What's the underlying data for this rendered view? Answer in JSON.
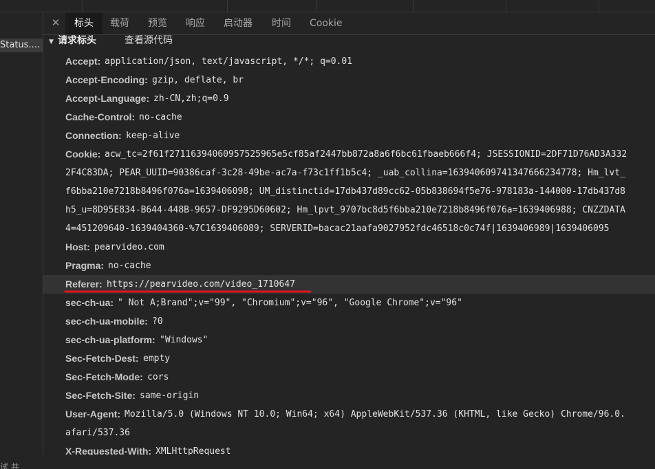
{
  "left_column": {
    "status_label": "Status....",
    "bottom_text": "试 共"
  },
  "tabs": {
    "close_icon": "close-icon",
    "items": [
      {
        "label": "标头",
        "active": true
      },
      {
        "label": "载荷",
        "active": false
      },
      {
        "label": "预览",
        "active": false
      },
      {
        "label": "响应",
        "active": false
      },
      {
        "label": "启动器",
        "active": false
      },
      {
        "label": "时间",
        "active": false
      },
      {
        "label": "Cookie",
        "active": false
      }
    ]
  },
  "section": {
    "title": "请求标头",
    "view_source": "查看源代码"
  },
  "headers": [
    {
      "key": "Accept:",
      "value": "application/json, text/javascript, */*; q=0.01"
    },
    {
      "key": "Accept-Encoding:",
      "value": "gzip, deflate, br"
    },
    {
      "key": "Accept-Language:",
      "value": "zh-CN,zh;q=0.9"
    },
    {
      "key": "Cache-Control:",
      "value": "no-cache"
    },
    {
      "key": "Connection:",
      "value": "keep-alive"
    },
    {
      "key": "Cookie:",
      "value": "acw_tc=2f61f27116394060957525965e5cf85af2447bb872a8a6f6bc61fbaeb666f4; JSESSIONID=2DF71D76AD3A332"
    },
    {
      "continuation": "2F4C83DA; PEAR_UUID=90386caf-3c28-49be-ac7a-f73c1ff1b5c4; _uab_collina=163940609741347666234778; Hm_lvt_"
    },
    {
      "continuation": "f6bba210e7218b8496f076a=1639406098; UM_distinctid=17db437d89cc62-05b838694f5e76-978183a-144000-17db437d8"
    },
    {
      "continuation": "h5_u=8D95E834-B644-448B-9657-DF9295D60602; Hm_lpvt_9707bc8d5f6bba210e7218b8496f076a=1639406988; CNZZDATA"
    },
    {
      "continuation": "4=451209640-1639404360-%7C1639406089; SERVERID=bacac21aafa9027952fdc46518c0c74f|1639406989|1639406095"
    },
    {
      "key": "Host:",
      "value": "pearvideo.com"
    },
    {
      "key": "Pragma:",
      "value": "no-cache"
    },
    {
      "key": "Referer:",
      "value": "https://pearvideo.com/video_1710647",
      "highlighted": true
    },
    {
      "key": "sec-ch-ua:",
      "value": "\" Not A;Brand\";v=\"99\", \"Chromium\";v=\"96\", \"Google Chrome\";v=\"96\""
    },
    {
      "key": "sec-ch-ua-mobile:",
      "value": "?0"
    },
    {
      "key": "sec-ch-ua-platform:",
      "value": "\"Windows\""
    },
    {
      "key": "Sec-Fetch-Dest:",
      "value": "empty"
    },
    {
      "key": "Sec-Fetch-Mode:",
      "value": "cors"
    },
    {
      "key": "Sec-Fetch-Site:",
      "value": "same-origin"
    },
    {
      "key": "User-Agent:",
      "value": "Mozilla/5.0 (Windows NT 10.0; Win64; x64) AppleWebKit/537.36 (KHTML, like Gecko) Chrome/96.0."
    },
    {
      "continuation": "afari/537.36"
    },
    {
      "key": "X-Requested-With:",
      "value": "XMLHttpRequest"
    }
  ],
  "colors": {
    "background": "#242424",
    "highlight_row": "#333333",
    "annotation_underline": "#e0141e"
  }
}
